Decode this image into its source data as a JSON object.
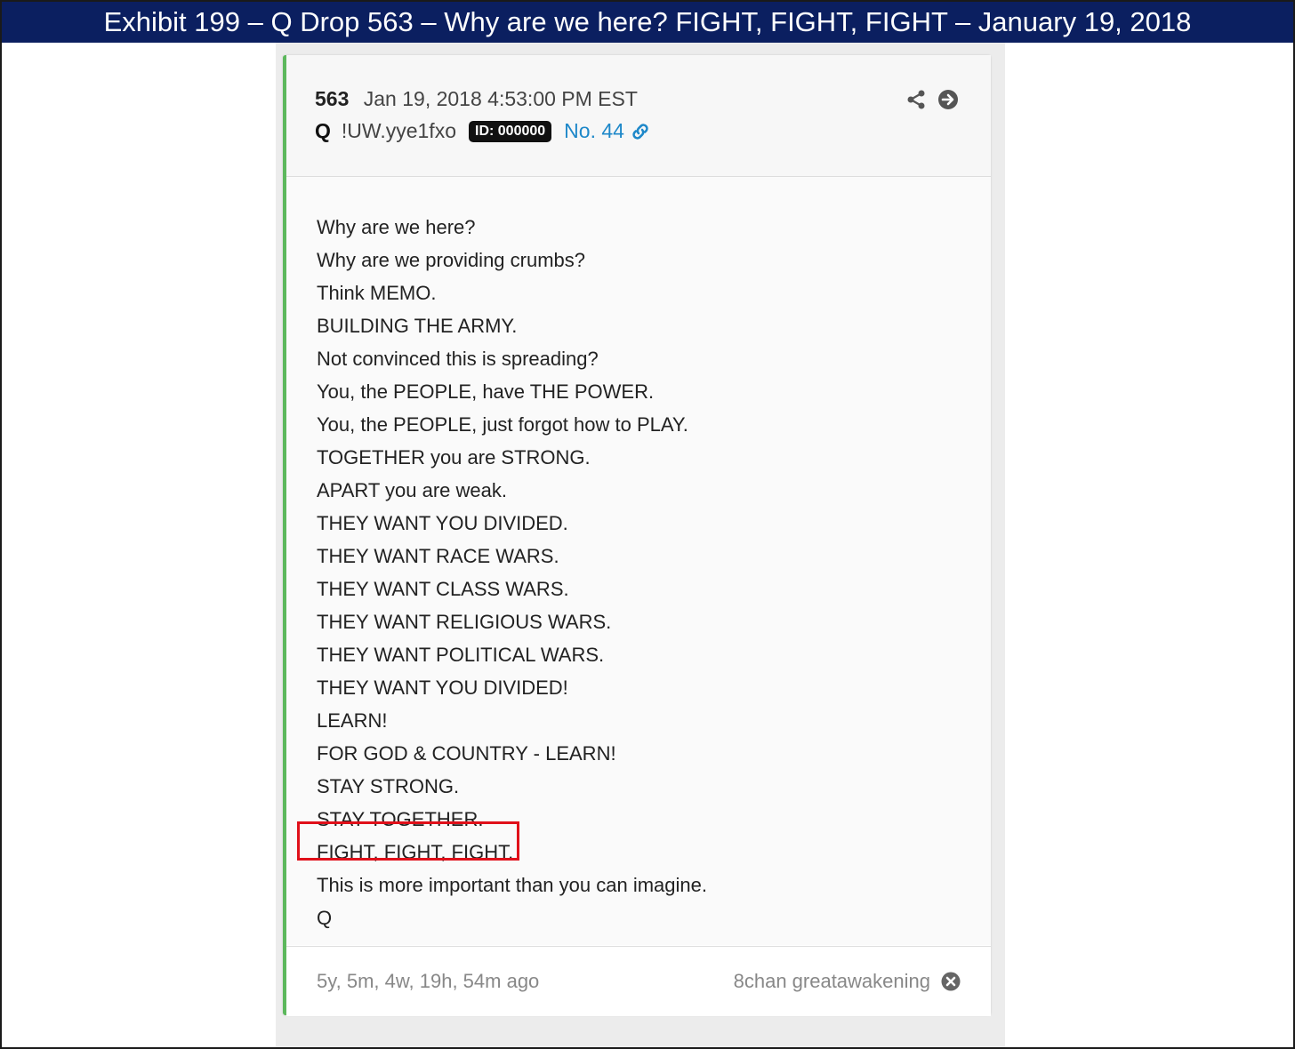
{
  "banner": {
    "title": "Exhibit 199 – Q Drop 563 – Why are we here? FIGHT, FIGHT, FIGHT – January 19, 2018"
  },
  "post": {
    "number": "563",
    "date": "Jan 19, 2018 4:53:00 PM EST",
    "author": "Q",
    "tripcode": "!UW.yye1fxo",
    "id_badge": "ID: 000000",
    "post_no": "No. 44",
    "lines": [
      "Why are we here?",
      "Why are we providing crumbs?",
      "Think MEMO.",
      "BUILDING THE ARMY.",
      "Not convinced this is spreading?",
      "You, the PEOPLE, have THE POWER.",
      "You, the PEOPLE, just forgot how to PLAY.",
      "TOGETHER you are STRONG.",
      "APART you are weak.",
      "THEY WANT YOU DIVIDED.",
      "THEY WANT RACE WARS.",
      "THEY WANT CLASS WARS.",
      "THEY WANT RELIGIOUS WARS.",
      "THEY WANT POLITICAL WARS.",
      "THEY WANT YOU DIVIDED!",
      "LEARN!",
      "FOR GOD & COUNTRY - LEARN!",
      "STAY STRONG.",
      "STAY TOGETHER.",
      "FIGHT, FIGHT, FIGHT.",
      "This is more important than you can imagine.",
      "Q"
    ],
    "age": "5y, 5m, 4w, 19h, 54m ago",
    "source": "8chan greatawakening"
  },
  "icons": {
    "share": "share-icon",
    "navigate": "arrow-right-circle-icon",
    "link": "link-icon",
    "close": "close-circle-icon"
  },
  "colors": {
    "banner_bg": "#0b1f60",
    "accent_border": "#5cb85c",
    "link": "#1e88c9",
    "highlight_box": "#e0101a"
  }
}
